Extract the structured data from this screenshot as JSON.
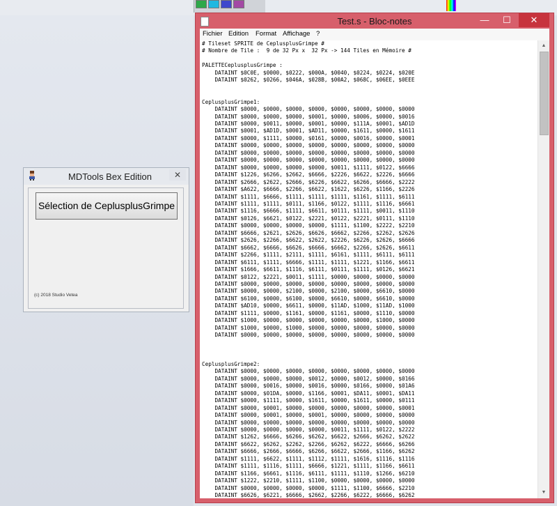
{
  "colors": {
    "notepad_frame": "#d75f6b",
    "notepad_close": "#c7333d",
    "palette_swatches": [
      "#2ea84a",
      "#20b8e0",
      "#3f48cc",
      "#a349a4",
      "#e8d44b",
      "#7fb0d8",
      "#6a75c9",
      "#c8bfe7"
    ]
  },
  "mdtools": {
    "title": "MDTools Bex Edition",
    "close_label": "✕",
    "app_icon": "character-sprite-icon",
    "button_label": "Sélection de CeplusplusGrimpe",
    "copyright": "(c) 2018 Studio Vetea"
  },
  "notepad": {
    "title": "Test.s - Bloc-notes",
    "minimize_label": "—",
    "maximize_label": "☐",
    "close_label": "✕",
    "menu": [
      "Fichier",
      "Edition",
      "Format",
      "Affichage",
      "?"
    ],
    "scroll_up": "▲",
    "scroll_down": "▼",
    "lines": [
      "# Tileset SPRITE de CeplusplusGrimpe #",
      "# Nombre de Tile :  9 de 32 Px x  32 Px -> 144 Tiles en Mémoire #",
      "",
      "PALETTECeplusplusGrimpe :",
      "    DATAINT $0C0E, $0000, $0222, $000A, $0040, $0224, $0224, $020E",
      "    DATAINT $0262, $0266, $046A, $028B, $00A2, $068C, $06EE, $0EEE",
      "",
      "",
      "CeplusplusGrimpe1:",
      "    DATAINT $0000, $0000, $0000, $0000, $0000, $0000, $0000, $0000",
      "    DATAINT $0000, $0000, $0000, $0001, $0000, $0006, $0000, $0016",
      "    DATAINT $0000, $0011, $0000, $0001, $0000, $111A, $0001, $AD1D",
      "    DATAINT $0001, $AD1D, $0001, $AD11, $0000, $1611, $0000, $1611",
      "    DATAINT $0000, $1111, $0000, $0161, $0000, $0016, $0000, $0001",
      "    DATAINT $0000, $0000, $0000, $0000, $0000, $0000, $0000, $0000",
      "    DATAINT $0000, $0000, $0000, $0000, $0000, $0000, $0000, $0000",
      "    DATAINT $0000, $0000, $0000, $0000, $0000, $0000, $0000, $0000",
      "    DATAINT $0000, $0000, $0000, $0000, $0011, $1111, $0122, $6666",
      "    DATAINT $1226, $6266, $2662, $6666, $2226, $6622, $2226, $6666",
      "    DATAINT $2666, $2622, $2666, $6226, $6622, $6266, $6666, $2222",
      "    DATAINT $A622, $6666, $2266, $6622, $1622, $6226, $1166, $2226",
      "    DATAINT $1111, $6666, $1111, $1111, $1111, $1161, $1111, $6111",
      "    DATAINT $1111, $1111, $0111, $1166, $0122, $1111, $1116, $6661",
      "    DATAINT $1116, $6666, $1111, $6611, $0111, $1111, $0011, $1110",
      "    DATAINT $0126, $6621, $0122, $2221, $0122, $2221, $0111, $1110",
      "    DATAINT $0000, $0000, $0000, $0000, $1111, $1100, $2222, $2210",
      "    DATAINT $6666, $2621, $2626, $6626, $6662, $2266, $2262, $2626",
      "    DATAINT $2626, $2266, $6622, $2622, $2226, $6226, $2626, $6666",
      "    DATAINT $6662, $6666, $6626, $6666, $6662, $2266, $2626, $6611",
      "    DATAINT $2266, $1111, $2111, $1111, $6161, $1111, $6111, $6111",
      "    DATAINT $6111, $1111, $6666, $1111, $1111, $1221, $1166, $6611",
      "    DATAINT $1666, $6611, $1116, $6111, $0111, $1111, $0126, $6621",
      "    DATAINT $0122, $2221, $0011, $1111, $0000, $0000, $0000, $0000",
      "    DATAINT $0000, $0000, $0000, $0000, $0000, $0000, $0000, $0000",
      "    DATAINT $0000, $0000, $2100, $0000, $2100, $0000, $6610, $0000",
      "    DATAINT $6100, $0000, $6100, $0000, $6610, $0000, $6610, $0000",
      "    DATAINT $AD10, $0000, $6611, $0000, $11AD, $1000, $11AD, $1000",
      "    DATAINT $1111, $0000, $1161, $0000, $1161, $0000, $1110, $0000",
      "    DATAINT $1000, $0000, $0000, $0000, $0000, $0000, $1000, $0000",
      "    DATAINT $1000, $0000, $1000, $0000, $0000, $0000, $0000, $0000",
      "    DATAINT $0000, $0000, $0000, $0000, $0000, $0000, $0000, $0000",
      "",
      "",
      "",
      "CeplusplusGrimpe2:",
      "    DATAINT $0000, $0000, $0000, $0000, $0000, $0000, $0000, $0000",
      "    DATAINT $0000, $0000, $0000, $0012, $0000, $0012, $0000, $0166",
      "    DATAINT $0000, $0016, $0000, $0016, $0000, $0166, $0000, $01A6",
      "    DATAINT $0000, $01DA, $0000, $1166, $0001, $DA11, $0001, $DA11",
      "    DATAINT $0000, $1111, $0000, $1611, $0000, $1611, $0000, $0111",
      "    DATAINT $0000, $0001, $0000, $0000, $0000, $0000, $0000, $0001",
      "    DATAINT $0000, $0001, $0000, $0001, $0000, $0000, $0000, $0000",
      "    DATAINT $0000, $0000, $0000, $0000, $0000, $0000, $0000, $0000",
      "    DATAINT $0000, $0000, $0000, $0000, $0011, $1111, $0122, $2222",
      "    DATAINT $1262, $6666, $6266, $6262, $6622, $2666, $6262, $2622",
      "    DATAINT $6622, $6262, $2262, $2266, $6262, $6222, $6666, $6266",
      "    DATAINT $6666, $2666, $6666, $6266, $6622, $2666, $1166, $6262",
      "    DATAINT $1111, $6622, $1111, $1112, $1111, $1616, $1116, $1116",
      "    DATAINT $1111, $1116, $1111, $6666, $1221, $1111, $1166, $6611",
      "    DATAINT $1166, $6661, $1116, $6111, $1111, $1110, $1266, $6210",
      "    DATAINT $1222, $2210, $1111, $1100, $0000, $0000, $0000, $0000",
      "    DATAINT $0000, $0000, $0000, $0000, $1111, $1100, $6666, $2210",
      "    DATAINT $6626, $6221, $6666, $2662, $2266, $6222, $6666, $6262"
    ]
  }
}
